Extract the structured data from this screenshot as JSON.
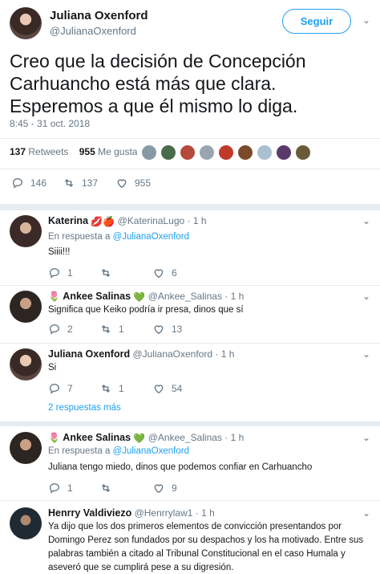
{
  "main": {
    "name": "Juliana Oxenford",
    "handle": "@JulianaOxenford",
    "follow_label": "Seguir",
    "text": "Creo que la decisión de Concepción Carhuancho está más que clara. Esperemos a que él mismo lo diga.",
    "timestamp": "8:45 - 31 oct. 2018",
    "retweets_count": "137",
    "retweets_label": "Retweets",
    "likes_count": "955",
    "likes_label": "Me gusta",
    "actions": {
      "replies": "146",
      "retweets": "137",
      "likes": "955"
    }
  },
  "replies": [
    {
      "name": "Katerina",
      "emoji": "💋🍎",
      "handle": "@KaterinaLugo",
      "time": "· 1 h",
      "in_reply_prefix": "En respuesta a",
      "in_reply_to": "@JulianaOxenford",
      "text": "Siiii!!!",
      "actions": {
        "replies": "1",
        "retweets": "",
        "likes": "6"
      }
    },
    {
      "name": "Ankee Salinas",
      "emoji": "💚",
      "handle": "@Ankee_Salinas",
      "time": "· 1 h",
      "text": "Significa que Keiko podría ir presa, dinos que sí",
      "actions": {
        "replies": "2",
        "retweets": "1",
        "likes": "13"
      }
    },
    {
      "name": "Juliana Oxenford",
      "handle": "@JulianaOxenford",
      "time": "· 1 h",
      "text": "Si",
      "actions": {
        "replies": "7",
        "retweets": "1",
        "likes": "54"
      },
      "more_replies": "2 respuestas más"
    },
    {
      "name": "Ankee Salinas",
      "emoji": "💚",
      "handle": "@Ankee_Salinas",
      "time": "· 1 h",
      "in_reply_prefix": "En respuesta a",
      "in_reply_to": "@JulianaOxenford",
      "text": "Juliana tengo miedo, dinos que podemos confiar en Carhuancho",
      "actions": {
        "replies": "1",
        "retweets": "",
        "likes": "9"
      }
    },
    {
      "name": "Henrry Valdiviezo",
      "handle": "@Henrrylaw1",
      "time": "· 1 h",
      "text": "Ya dijo que los dos primeros elementos de convicción presentandos por Domingo Perez son fundados por su despachos y los ha motivado. Entre sus palabras también a citado al Tribunal Constitucional en el caso Humala y aseveró que se cumplirá pese a su digresión."
    }
  ],
  "colors": {
    "accent": "#1da1f2",
    "muted": "#657786",
    "text": "#14171a",
    "divider": "#e6ecf0"
  }
}
